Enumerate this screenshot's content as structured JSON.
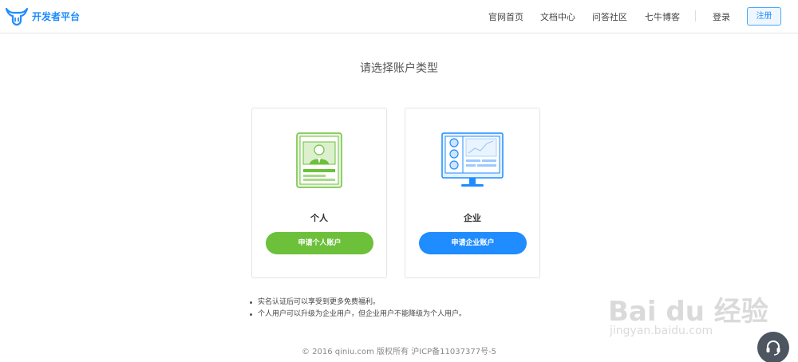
{
  "header": {
    "logo_text": "开发者平台",
    "nav": [
      "官网首页",
      "文档中心",
      "问答社区",
      "七牛博客"
    ],
    "login": "登录",
    "register": "注册"
  },
  "main": {
    "title": "请选择账户类型",
    "cards": [
      {
        "label": "个人",
        "button": "申请个人账户"
      },
      {
        "label": "企业",
        "button": "申请企业账户"
      }
    ],
    "notes": [
      "实名认证后可以享受到更多免费福利。",
      "个人用户可以升级为企业用户，但企业用户不能降级为个人用户。"
    ]
  },
  "footer": {
    "text": "© 2016 qiniu.com 版权所有 沪ICP备11037377号-5"
  },
  "watermark": {
    "brand": "Bai du 经验",
    "url": "jingyan.baidu.com"
  },
  "colors": {
    "brand_blue": "#1f8cff",
    "green": "#6cc03a"
  },
  "icons": {
    "logo": "qiniu-bull-logo",
    "support": "headset-icon"
  }
}
